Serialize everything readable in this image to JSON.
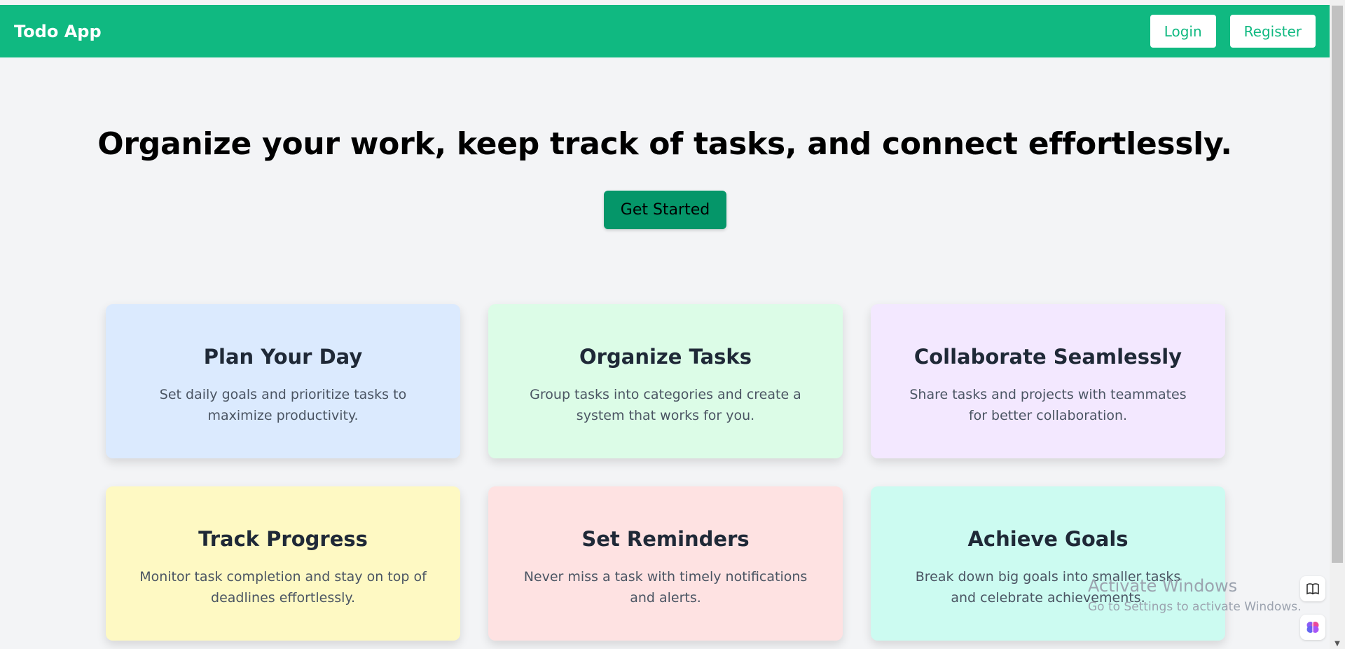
{
  "navbar": {
    "brand": "Todo App",
    "login_label": "Login",
    "register_label": "Register"
  },
  "hero": {
    "title": "Organize your work, keep track of tasks, and connect effortlessly.",
    "cta_label": "Get Started"
  },
  "cards": [
    {
      "title": "Plan Your Day",
      "desc": "Set daily goals and prioritize tasks to maximize productivity.",
      "color": "#dbeafe"
    },
    {
      "title": "Organize Tasks",
      "desc": "Group tasks into categories and create a system that works for you.",
      "color": "#dcfce7"
    },
    {
      "title": "Collaborate Seamlessly",
      "desc": "Share tasks and projects with teammates for better collaboration.",
      "color": "#f3e8ff"
    },
    {
      "title": "Track Progress",
      "desc": "Monitor task completion and stay on top of deadlines effortlessly.",
      "color": "#fef9c3"
    },
    {
      "title": "Set Reminders",
      "desc": "Never miss a task with timely notifications and alerts.",
      "color": "#fee2e2"
    },
    {
      "title": "Achieve Goals",
      "desc": "Break down big goals into smaller tasks and celebrate achievements.",
      "color": "#ccfbf1"
    }
  ],
  "watermark": {
    "title": "Activate Windows",
    "subtitle": "Go to Settings to activate Windows."
  },
  "colors": {
    "brand": "#10b981",
    "cta": "#059669",
    "background": "#f3f4f6"
  }
}
